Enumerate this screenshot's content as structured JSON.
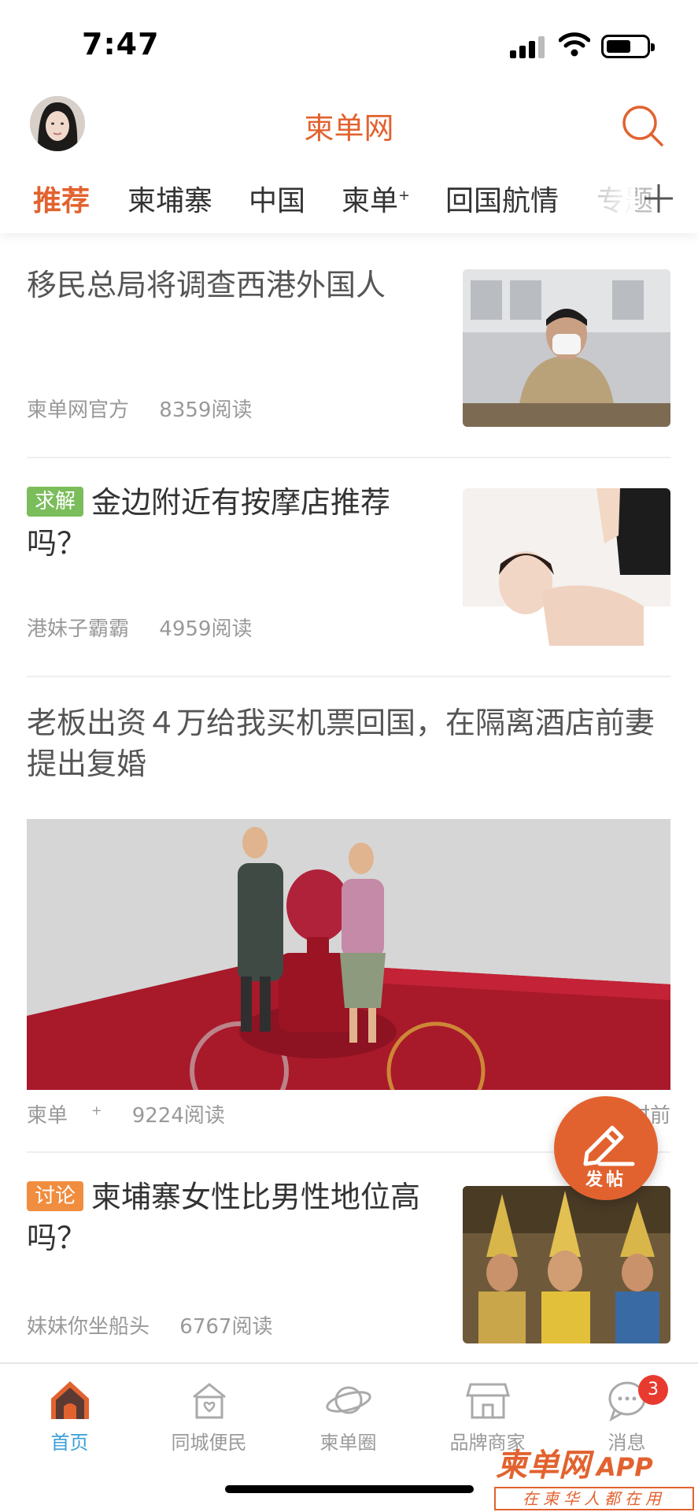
{
  "status_bar": {
    "time": "7:47"
  },
  "header": {
    "title": "柬单网"
  },
  "tabs": [
    {
      "label": "推荐",
      "active": true
    },
    {
      "label": "柬埔寨"
    },
    {
      "label": "中国"
    },
    {
      "label": "柬单",
      "sup": "+"
    },
    {
      "label": "回国航情"
    },
    {
      "label": "专题"
    }
  ],
  "articles": [
    {
      "title": "移民总局将调查西港外国人",
      "author": "柬单网官方",
      "reads": "8359阅读",
      "image": "official-photo"
    },
    {
      "badge": "求解",
      "badge_color": "#7bbd5b",
      "title": "金边附近有按摩店推荐吗？",
      "author": "港妹子霸霸",
      "reads": "4959阅读",
      "image": "massage-photo"
    },
    {
      "title": "老板出资４万给我买机票回国，在隔离酒店前妻提出复婚",
      "author": "柬单",
      "author_sup": "+",
      "reads": "9224阅读",
      "time_partial": "时前",
      "image": "marriage-photo"
    },
    {
      "badge": "讨论",
      "badge_color": "#f08d3f",
      "title": "柬埔寨女性比男性地位高吗？",
      "author": "妹妹你坐船头",
      "reads": "6767阅读",
      "image": "dancers-photo"
    }
  ],
  "fab": {
    "label": "发帖"
  },
  "bottom_nav": [
    {
      "label": "首页",
      "icon": "home-icon",
      "active": true
    },
    {
      "label": "同城便民",
      "icon": "community-icon"
    },
    {
      "label": "柬单圈",
      "icon": "planet-icon"
    },
    {
      "label": "品牌商家",
      "icon": "store-icon"
    },
    {
      "label": "消息",
      "icon": "chat-icon",
      "badge": "3"
    }
  ],
  "watermark": {
    "title": "柬单网",
    "title_suffix": "APP",
    "subtitle": "在柬华人都在用"
  },
  "colors": {
    "accent": "#e2622f",
    "active_nav": "#3aa0d8",
    "badge_red": "#e83a2e"
  }
}
